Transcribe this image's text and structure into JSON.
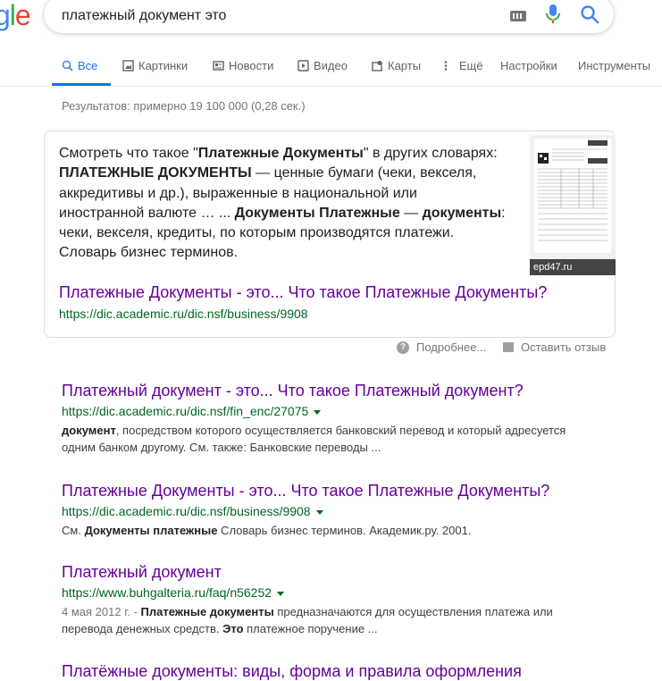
{
  "logo": {
    "g": "g",
    "l": "l",
    "e": "e"
  },
  "search": {
    "query": "платежный документ это"
  },
  "tabs": [
    {
      "label": "Все",
      "icon": "search-icon"
    },
    {
      "label": "Картинки",
      "icon": "image-icon"
    },
    {
      "label": "Новости",
      "icon": "news-icon"
    },
    {
      "label": "Видео",
      "icon": "video-icon"
    },
    {
      "label": "Карты",
      "icon": "map-icon"
    },
    {
      "label": "Ещё",
      "icon": "more-icon"
    },
    {
      "label": "Настройки",
      "icon": ""
    },
    {
      "label": "Инструменты",
      "icon": ""
    }
  ],
  "stats": "Результатов: примерно 19 100 000 (0,28 сек.)",
  "featured": {
    "s1": "Смотреть что такое \"",
    "s1b": "Платежные Документы",
    "s2": "\" в других словарях: ",
    "s3b": "ПЛАТЕЖНЫЕ ДОКУМЕНТЫ",
    "s4": " — ценные бумаги (чеки, векселя, аккредитивы и др.), выраженные в национальной или иностранной валюте … ... ",
    "s5b": "Документы Платежные",
    "s6": " — ",
    "s7b": "документы",
    "s8": ": чеки, векселя, кредиты, по которым производятся платежи. Словарь бизнес терминов.",
    "image_caption": "epd47.ru",
    "title": "Платежные Документы - это... Что такое Платежные Документы?",
    "url": "https://dic.academic.ru/dic.nsf/business/9908"
  },
  "below": {
    "more": "Подробнее...",
    "feedback": "Оставить отзыв"
  },
  "results": [
    {
      "title": "Платежный документ - это... Что такое Платежный документ?",
      "url": "https://dic.academic.ru/dic.nsf/fin_enc/27075",
      "date": "",
      "b1": "документ",
      "t1": ", посредством которого осуществляется банковский перевод и который адресуется одним банком другому. См. также: Банковские переводы ..."
    },
    {
      "title": "Платежные Документы - это... Что такое Платежные Документы?",
      "url": "https://dic.academic.ru/dic.nsf/business/9908",
      "t0": "См. ",
      "b1": "Документы платежные",
      "t1": " Словарь бизнес терминов. Академик.ру. 2001."
    },
    {
      "title": "Платежный документ",
      "url": "https://www.buhgalteria.ru/faq/n56252",
      "date": "4 мая 2012 г. - ",
      "b1": "Платежные документы",
      "t1": " предназначаются для осуществления платежа или перевода денежных средств. ",
      "b2": "Это",
      "t2": " платежное поручение ..."
    },
    {
      "title": "Платёжные документы: виды, форма и правила оформления"
    }
  ]
}
